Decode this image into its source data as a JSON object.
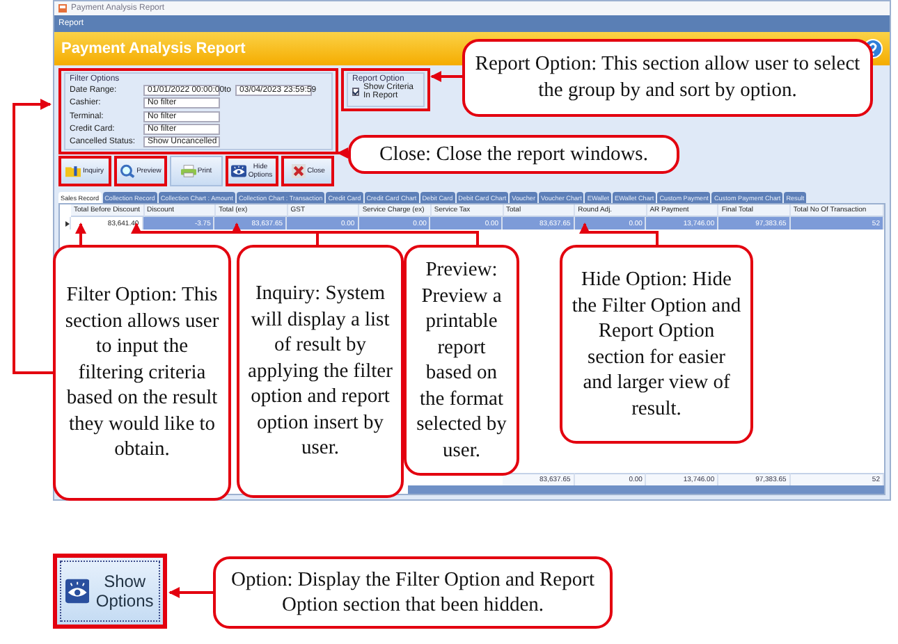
{
  "window": {
    "title": "Payment Analysis Report"
  },
  "menu": [
    "Report"
  ],
  "header": {
    "title": "Payment Analysis Report"
  },
  "filter_options": {
    "title": "Filter Options",
    "date_range": {
      "label": "Date Range:",
      "from": "01/01/2022 00:00:00",
      "separator": "to",
      "to": "03/04/2023 23:59:59"
    },
    "fields": [
      {
        "label": "Cashier:",
        "value": "No filter"
      },
      {
        "label": "Terminal:",
        "value": "No filter"
      },
      {
        "label": "Credit Card:",
        "value": "No filter"
      },
      {
        "label": "Cancelled Status:",
        "value": "Show Uncancelled"
      }
    ]
  },
  "report_option": {
    "title": "Report Option",
    "checkbox": {
      "label": "Show Criteria In Report",
      "checked": true
    }
  },
  "toolbar": [
    {
      "kind": "inquiry",
      "label": "Inquiry"
    },
    {
      "kind": "preview",
      "label": "Preview"
    },
    {
      "kind": "print",
      "label": "Print"
    },
    {
      "kind": "hide",
      "label": "Hide Options"
    },
    {
      "kind": "close",
      "label": "Close"
    }
  ],
  "tabs": [
    {
      "label": "Sales Record",
      "selected": true
    },
    {
      "label": "Collection Record",
      "selected": false
    },
    {
      "label": "Collection Chart : Amount",
      "selected": false
    },
    {
      "label": "Collection Chart : Transaction",
      "selected": false
    },
    {
      "label": "Credit Card",
      "selected": false
    },
    {
      "label": "Credit Card Chart",
      "selected": false
    },
    {
      "label": "Debit Card",
      "selected": false
    },
    {
      "label": "Debit Card Chart",
      "selected": false
    },
    {
      "label": "Voucher",
      "selected": false
    },
    {
      "label": "Voucher Chart",
      "selected": false
    },
    {
      "label": "EWallet",
      "selected": false
    },
    {
      "label": "EWallet Chart",
      "selected": false
    },
    {
      "label": "Custom Payment",
      "selected": false
    },
    {
      "label": "Custom Payment Chart",
      "selected": false
    },
    {
      "label": "Result",
      "selected": false
    }
  ],
  "table": {
    "columns": [
      "Total Before Discount",
      "Discount",
      "Total (ex)",
      "GST",
      "Service Charge (ex)",
      "Service Tax",
      "Total",
      "Round Adj.",
      "AR Payment",
      "Final Total",
      "Total No Of Transaction"
    ],
    "rows": [
      {
        "selected": true,
        "cells": [
          "83,641.40",
          "-3.75",
          "83,637.65",
          "0.00",
          "0.00",
          "0.00",
          "83,637.65",
          "0.00",
          "13,746.00",
          "97,383.65",
          "52"
        ]
      }
    ],
    "footer": [
      "83,637.65",
      "0.00",
      "13,746.00",
      "97,383.65",
      "52"
    ]
  },
  "callouts": [
    {
      "kind": "report",
      "text": "Report Option: This section allow user to select the group by and sort by option."
    },
    {
      "kind": "close",
      "text": "Close: Close the report windows."
    },
    {
      "kind": "filter",
      "text": "Filter Option: This section allows user to input the filtering criteria based on the result they would like to obtain."
    },
    {
      "kind": "inquiry",
      "text": "Inquiry: System will display a list of result by applying the filter option and report option insert by user."
    },
    {
      "kind": "preview",
      "text": "Preview: Preview a printable report based on the format selected by user."
    },
    {
      "kind": "hide",
      "text": "Hide Option: Hide the Filter Option and Report Option section for easier and larger view of result."
    }
  ],
  "show_options": {
    "button": {
      "label": "Show Options"
    },
    "callout": {
      "text": "Option: Display the Filter Option and Report Option section that been hidden."
    }
  }
}
